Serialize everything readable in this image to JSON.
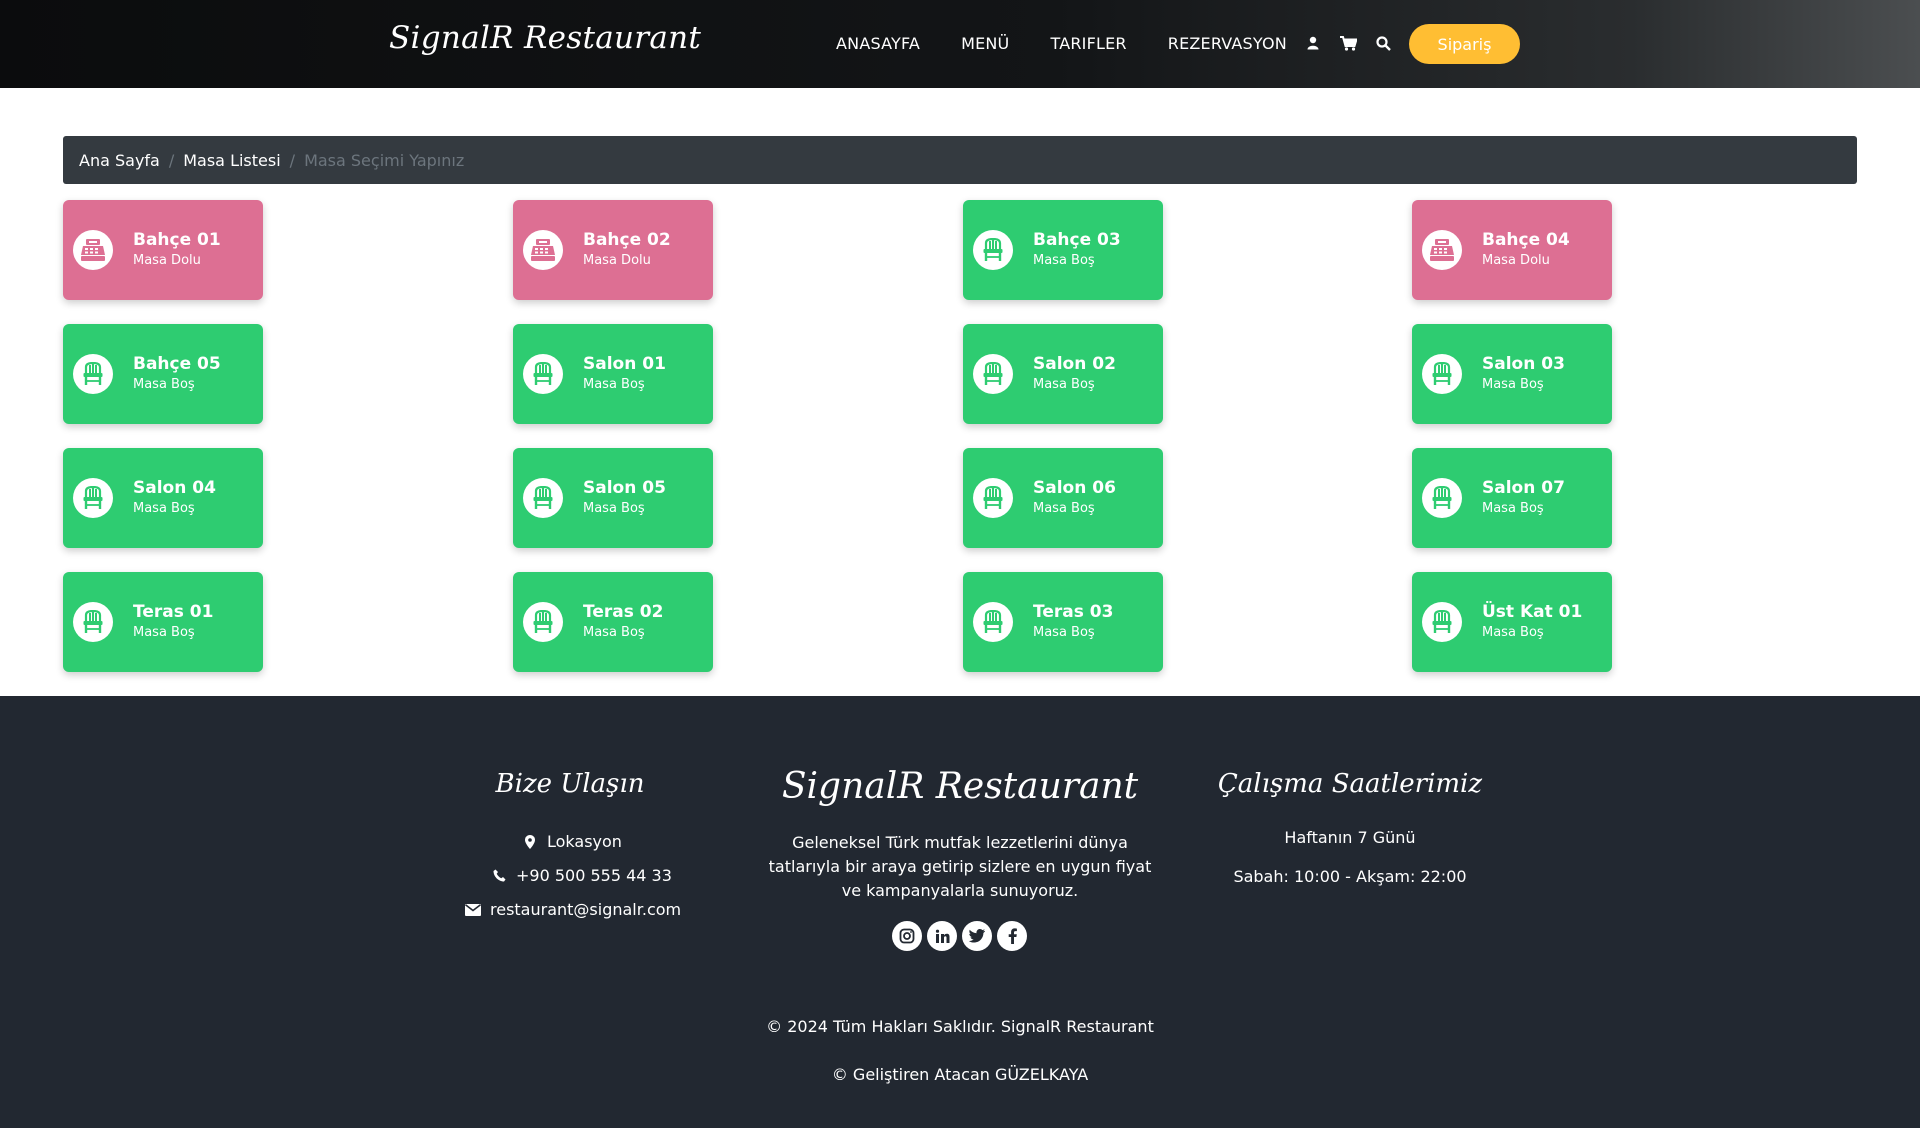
{
  "header": {
    "brand": "SignalR Restaurant",
    "nav": [
      "ANASAYFA",
      "MENÜ",
      "TARIFLER",
      "REZERVASYON"
    ],
    "icons": [
      "user-icon",
      "cart-icon",
      "search-icon"
    ],
    "order_button": "Sipariş",
    "colors": {
      "background": "#0b0c0d",
      "accent": "#ffbe33"
    }
  },
  "breadcrumb": {
    "home": "Ana Sayfa",
    "list": "Masa Listesi",
    "current": "Masa Seçimi Yapınız",
    "separator": "/"
  },
  "tables": [
    {
      "name": "Bahçe 01",
      "status": "Masa Dolu",
      "occupied": true
    },
    {
      "name": "Bahçe 02",
      "status": "Masa Dolu",
      "occupied": true
    },
    {
      "name": "Bahçe 03",
      "status": "Masa Boş",
      "occupied": false
    },
    {
      "name": "Bahçe 04",
      "status": "Masa Dolu",
      "occupied": true
    },
    {
      "name": "Bahçe 05",
      "status": "Masa Boş",
      "occupied": false
    },
    {
      "name": "Salon 01",
      "status": "Masa Boş",
      "occupied": false
    },
    {
      "name": "Salon 02",
      "status": "Masa Boş",
      "occupied": false
    },
    {
      "name": "Salon 03",
      "status": "Masa Boş",
      "occupied": false
    },
    {
      "name": "Salon 04",
      "status": "Masa Boş",
      "occupied": false
    },
    {
      "name": "Salon 05",
      "status": "Masa Boş",
      "occupied": false
    },
    {
      "name": "Salon 06",
      "status": "Masa Boş",
      "occupied": false
    },
    {
      "name": "Salon 07",
      "status": "Masa Boş",
      "occupied": false
    },
    {
      "name": "Teras 01",
      "status": "Masa Boş",
      "occupied": false
    },
    {
      "name": "Teras 02",
      "status": "Masa Boş",
      "occupied": false
    },
    {
      "name": "Teras 03",
      "status": "Masa Boş",
      "occupied": false
    },
    {
      "name": "Üst Kat 01",
      "status": "Masa Boş",
      "occupied": false
    }
  ],
  "table_colors": {
    "occupied": "#dd6f93",
    "free": "#2ecc71"
  },
  "footer": {
    "contact": {
      "title": "Bize Ulaşın",
      "location": "Lokasyon",
      "phone": "+90 500 555 44 33",
      "email": "restaurant@signalr.com"
    },
    "about": {
      "title": "SignalR Restaurant",
      "line1": "Geleneksel Türk mutfak lezzetlerini dünya",
      "line2": "tatlarıyla bir araya getirip sizlere en uygun fiyat",
      "line3": "ve kampanyalarla sunuyoruz."
    },
    "hours": {
      "title": "Çalışma Saatlerimiz",
      "days": "Haftanın 7 Günü",
      "time": "Sabah: 10:00 - Akşam: 22:00"
    },
    "socials": [
      "instagram-icon",
      "linkedin-icon",
      "twitter-icon",
      "facebook-icon"
    ],
    "copyright": "© 2024 Tüm Hakları Saklıdır. SignalR Restaurant",
    "developer": "© Geliştiren Atacan GÜZELKAYA",
    "colors": {
      "background": "#222831"
    }
  }
}
